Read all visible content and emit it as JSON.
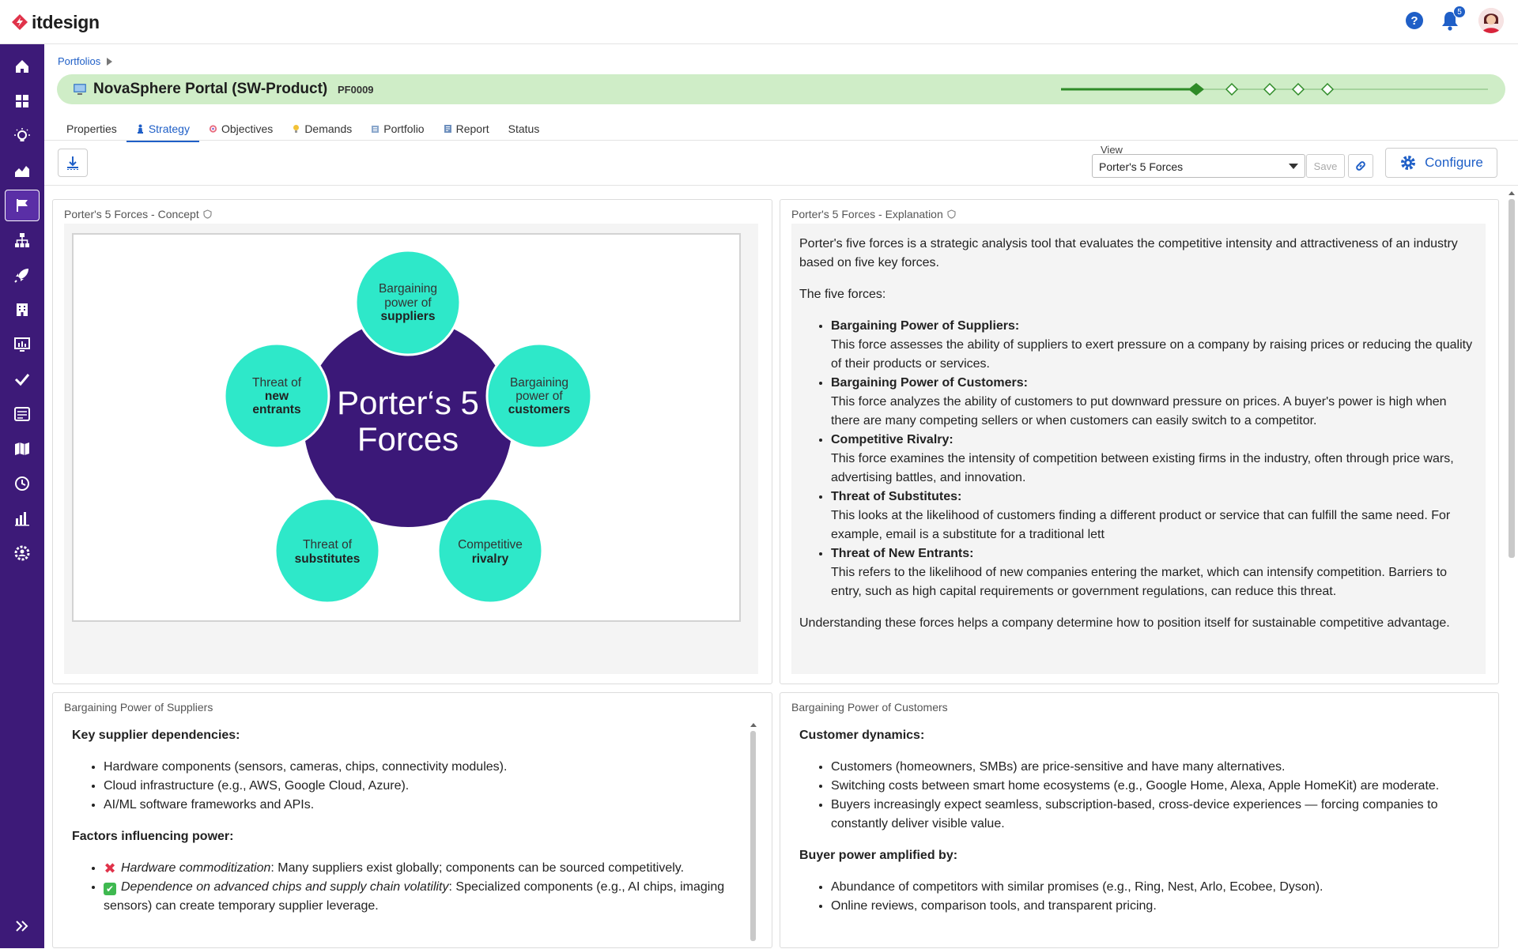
{
  "app": {
    "brand": "itdesign",
    "notifications_count": "5"
  },
  "breadcrumb": {
    "root": "Portfolios"
  },
  "project": {
    "title": "NovaSphere Portal (SW-Product)",
    "id": "PF0009"
  },
  "tabs": [
    {
      "label": "Properties"
    },
    {
      "label": "Strategy"
    },
    {
      "label": "Objectives"
    },
    {
      "label": "Demands"
    },
    {
      "label": "Portfolio"
    },
    {
      "label": "Report"
    },
    {
      "label": "Status"
    }
  ],
  "toolbar": {
    "view_label": "View",
    "view_value": "Porter's 5 Forces",
    "save_label": "Save",
    "configure_label": "Configure"
  },
  "concept_panel": {
    "title": "Porter's 5 Forces - Concept",
    "center_text_line1": "Porter‘s 5",
    "center_text_line2": "Forces",
    "forces": [
      {
        "line1": "Bargaining",
        "line2": "power of",
        "bold": "suppliers"
      },
      {
        "line1": "Bargaining",
        "line2": "power of",
        "bold": "customers"
      },
      {
        "line1": "Competitive",
        "line2": "",
        "bold": "rivalry"
      },
      {
        "line1": "Threat of",
        "line2": "",
        "bold": "substitutes"
      },
      {
        "line1": "Threat of",
        "line2": "new",
        "bold": "entrants"
      }
    ]
  },
  "explanation_panel": {
    "title": "Porter's 5 Forces - Explanation",
    "intro": "Porter's five forces is a strategic analysis tool that evaluates the competitive intensity and attractiveness of an industry based on five key forces.",
    "list_heading": "The five forces:",
    "items": [
      {
        "title": "Bargaining Power of Suppliers:",
        "text": "This force assesses the ability of suppliers to exert pressure on a company by raising prices or reducing the quality of their products or services."
      },
      {
        "title": "Bargaining Power of Customers:",
        "text": "This force analyzes the ability of customers to put downward pressure on prices. A buyer's power is high when there are many competing sellers or when customers can easily switch to a competitor."
      },
      {
        "title": "Competitive Rivalry:",
        "text": "This force examines the intensity of competition between existing firms in the industry, often through price wars, advertising battles, and innovation."
      },
      {
        "title": "Threat of Substitutes:",
        "text": "This looks at the likelihood of customers finding a different product or service that can fulfill the same need. For example, email is a substitute for a traditional lett"
      },
      {
        "title": "Threat of New Entrants:",
        "text": "This refers to the likelihood of new companies entering the market, which can intensify competition. Barriers to entry, such as high capital requirements or government regulations, can reduce this threat."
      }
    ],
    "conclusion": "Understanding these forces helps a company determine how to position itself for sustainable competitive advantage."
  },
  "suppliers_panel": {
    "title": "Bargaining Power of Suppliers",
    "heading1": "Key supplier dependencies:",
    "deps": [
      "Hardware components (sensors, cameras, chips, connectivity modules).",
      "Cloud infrastructure (e.g., AWS, Google Cloud, Azure).",
      "AI/ML software frameworks and APIs."
    ],
    "heading2": "Factors influencing power:",
    "factors": [
      {
        "mark": "✖",
        "em": "Hardware commoditization",
        "text": ": Many suppliers exist globally; components can be sourced competitively."
      },
      {
        "mark": "✔",
        "em": "Dependence on advanced chips and supply chain volatility",
        "text": ": Specialized components (e.g., AI chips, imaging sensors) can create temporary supplier leverage."
      }
    ]
  },
  "customers_panel": {
    "title": "Bargaining Power of Customers",
    "heading1": "Customer dynamics:",
    "dynamics": [
      "Customers (homeowners, SMBs) are price-sensitive and have many alternatives.",
      "Switching costs between smart home ecosystems (e.g., Google Home, Alexa, Apple HomeKit) are moderate.",
      "Buyers increasingly expect seamless, subscription-based, cross-device experiences — forcing companies to constantly deliver visible value."
    ],
    "heading2": "Buyer power amplified by:",
    "amplifiers": [
      "Abundance of competitors with similar promises (e.g., Ring, Nest, Arlo, Ecobee, Dyson).",
      "Online reviews, comparison tools, and transparent pricing."
    ]
  },
  "colors": {
    "sidebar": "#3d1a78",
    "accent": "#1f5fc7",
    "title_bar": "#cfedc7",
    "circle": "#2ee8c9",
    "center": "#3b1878",
    "stage_active": "#2e8b27"
  },
  "icons": [
    "home-icon",
    "dashboard-icon",
    "lightbulb-icon",
    "area-chart-icon",
    "flag-icon",
    "hierarchy-icon",
    "rocket-icon",
    "building-icon",
    "monitor-chart-icon",
    "check-icon",
    "list-icon",
    "map-icon",
    "clock-icon",
    "bar-chart-icon",
    "settings-user-icon",
    "expand-icon",
    "help-icon",
    "bell-icon",
    "gear-icon",
    "link-icon",
    "export-icon"
  ]
}
